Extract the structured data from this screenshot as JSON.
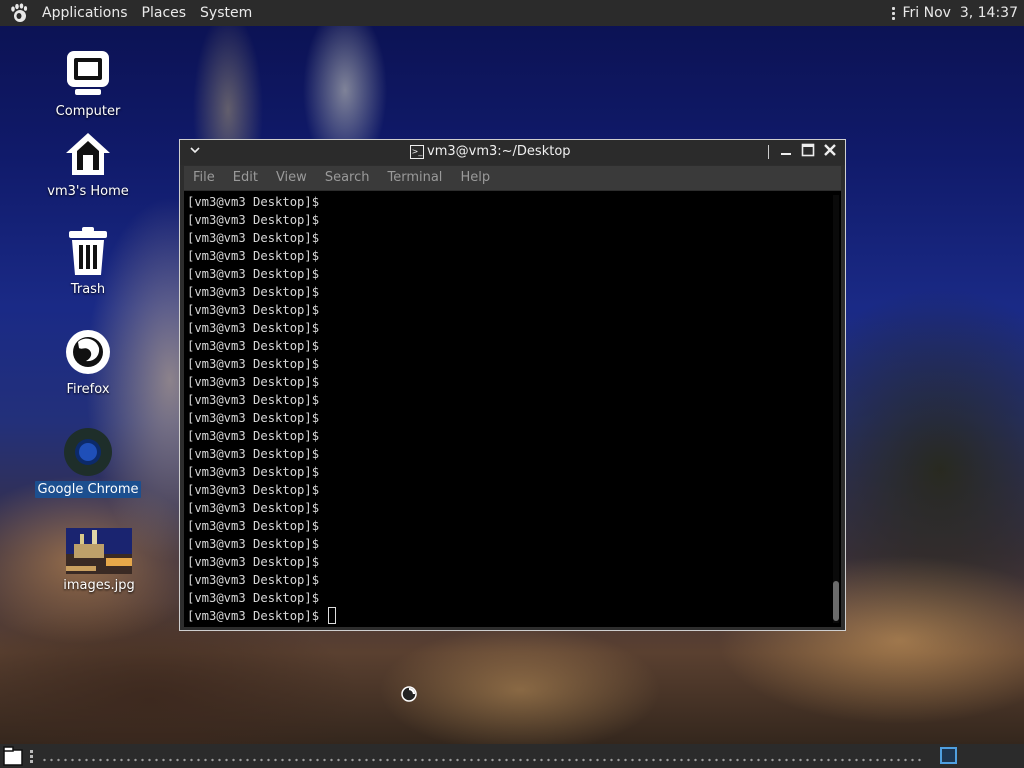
{
  "top_panel": {
    "menus": [
      "Applications",
      "Places",
      "System"
    ],
    "clock": "Fri Nov  3, 14:37"
  },
  "desktop_icons": [
    {
      "label": "Computer"
    },
    {
      "label": "vm3's Home"
    },
    {
      "label": "Trash"
    },
    {
      "label": "Firefox"
    },
    {
      "label": "Google Chrome",
      "selected": true
    },
    {
      "label": "images.jpg"
    }
  ],
  "terminal": {
    "title": "vm3@vm3:~/Desktop",
    "menus": [
      "File",
      "Edit",
      "View",
      "Search",
      "Terminal",
      "Help"
    ],
    "prompt": "[vm3@vm3 Desktop]$",
    "prompt_lines": 24
  },
  "colors": {
    "panel": "#2b2b2b",
    "selection": "#1c4f8f",
    "workspace_active": "#4f9fe0"
  }
}
